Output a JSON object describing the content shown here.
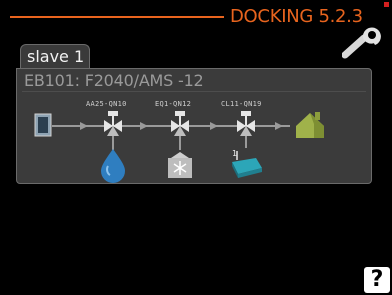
{
  "header": {
    "title": "DOCKING 5.2.3",
    "accent_color": "#e8641e",
    "icon": "wrench-icon"
  },
  "tab": {
    "label": "slave 1"
  },
  "panel": {
    "title": "EB101:  F2040/AMS -12",
    "components": [
      {
        "label": "AA25-QN10",
        "icon": "valve-icon",
        "target_icon": "water-drop-icon"
      },
      {
        "label": "EQ1-QN12",
        "icon": "valve-icon",
        "target_icon": "cooling-snowflake-icon"
      },
      {
        "label": "CL11-QN19",
        "icon": "valve-icon",
        "target_icon": "pool-icon"
      }
    ],
    "source_icon": "outdoor-unit-icon",
    "destination_icon": "house-icon"
  },
  "footer": {
    "help_label": "?"
  }
}
